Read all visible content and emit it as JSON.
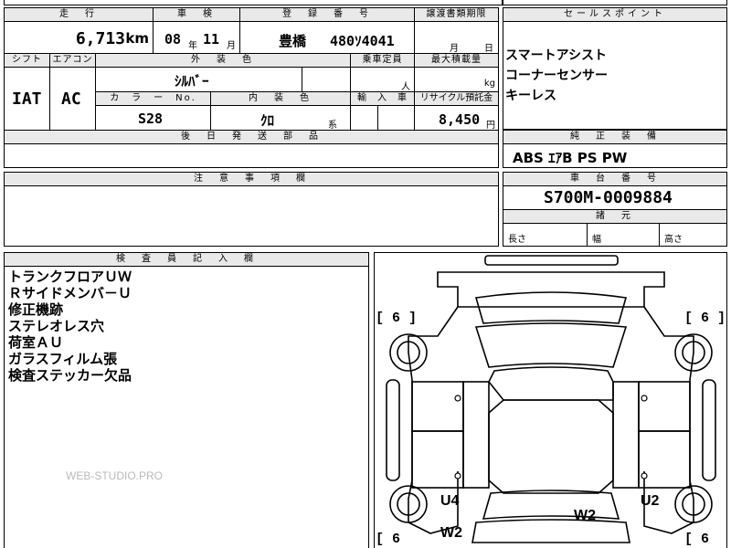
{
  "top": {
    "mileage_label": "走　行",
    "mileage_value": "6,713",
    "mileage_unit": "km",
    "inspection_label": "車　検",
    "inspection_year": "08",
    "inspection_year_unit": "年",
    "inspection_month": "11",
    "inspection_month_unit": "月",
    "reg_label": "登　録　番　号",
    "reg_area": "豊橋",
    "reg_number": "480ｿ4041",
    "transfer_label": "譲渡書類期限",
    "transfer_month": "月",
    "transfer_day": "日"
  },
  "row2": {
    "shift_label": "シフト",
    "shift_value": "IAT",
    "aircon_label": "エアコン",
    "aircon_value": "AC",
    "color_label": "外　装　色",
    "color_value": "ｼﾙﾊﾞｰ",
    "capacity_label": "乗車定員",
    "capacity_unit": "人",
    "load_label": "最大積載量",
    "load_unit": "kg",
    "color_no_label": "カ　ラ　ー　No.",
    "color_no_value": "S28",
    "interior_label": "内　装　色",
    "interior_value": "ｸﾛ",
    "interior_suffix": "系",
    "import_label": "輸　入　車",
    "recycle_label": "リサイクル預託金",
    "recycle_value": "8,450",
    "recycle_unit": "円",
    "later_parts_label": "後　日　発　送　部　品"
  },
  "sales": {
    "header": "セールスポイント",
    "points": [
      "スマートアシスト",
      "コーナーセンサー",
      "キーレス"
    ]
  },
  "equipment": {
    "header": "純　正　装　備",
    "value": "ABS ｴｱB PS PW"
  },
  "caution": {
    "header": "注　意　事　項　欄"
  },
  "chassis": {
    "header": "車　台　番　号",
    "value": "S700M-0009884",
    "spec_header": "諸　元",
    "length_label": "長さ",
    "width_label": "幅",
    "height_label": "高さ"
  },
  "inspector": {
    "header": "検　査　員　記　入　欄",
    "notes": [
      "トランクフロアＵＷ",
      "Ｒサイドメンバ－Ｕ",
      "修正機跡",
      "ステレオレス穴",
      "荷室ＡＵ",
      "ガラスフィルム張",
      "検査ステッカー欠品"
    ]
  },
  "diagram": {
    "tire_tl": "[ 6 ]",
    "tire_tr": "[ 6 ]",
    "tire_bl": "[ 6",
    "tire_br": "[ 6",
    "mark_u4": "U4",
    "mark_u2": "U2",
    "mark_w2_left": "W2",
    "mark_w2_mid": "W2"
  },
  "watermark": "WEB-STUDIO.PRO"
}
